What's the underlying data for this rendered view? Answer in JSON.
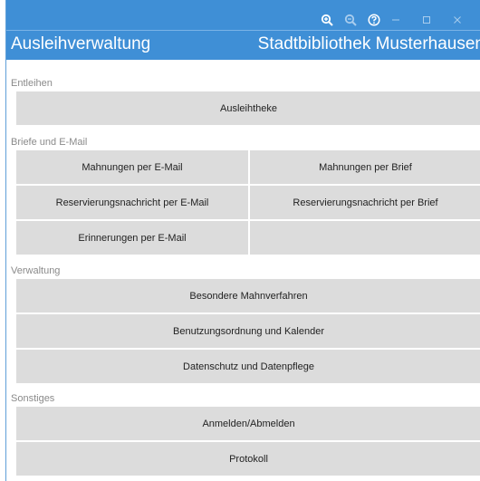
{
  "header": {
    "app_title": "Ausleihverwaltung",
    "library_name": "Stadtbibliothek Musterhausen",
    "accent_color": "#3f8fd6",
    "icons": [
      "zoom-in-icon",
      "zoom-out-icon",
      "help-icon",
      "minimize-icon",
      "maximize-icon",
      "close-icon"
    ]
  },
  "sections": {
    "entleihen": {
      "label": "Entleihen",
      "ausleihtheke": "Ausleihtheke"
    },
    "briefe": {
      "label": "Briefe und E-Mail",
      "mahnungen_email": "Mahnungen per E-Mail",
      "mahnungen_brief": "Mahnungen per Brief",
      "reservierung_email": "Reservierungsnachricht per E-Mail",
      "reservierung_brief": "Reservierungsnachricht per Brief",
      "erinnerungen_email": "Erinnerungen per E-Mail"
    },
    "verwaltung": {
      "label": "Verwaltung",
      "mahnverfahren": "Besondere Mahnverfahren",
      "benutzungsordnung": "Benutzungsordnung und Kalender",
      "datenschutz": "Datenschutz und Datenpflege"
    },
    "sonstiges": {
      "label": "Sonstiges",
      "anmelden": "Anmelden/Abmelden",
      "protokoll": "Protokoll"
    }
  }
}
